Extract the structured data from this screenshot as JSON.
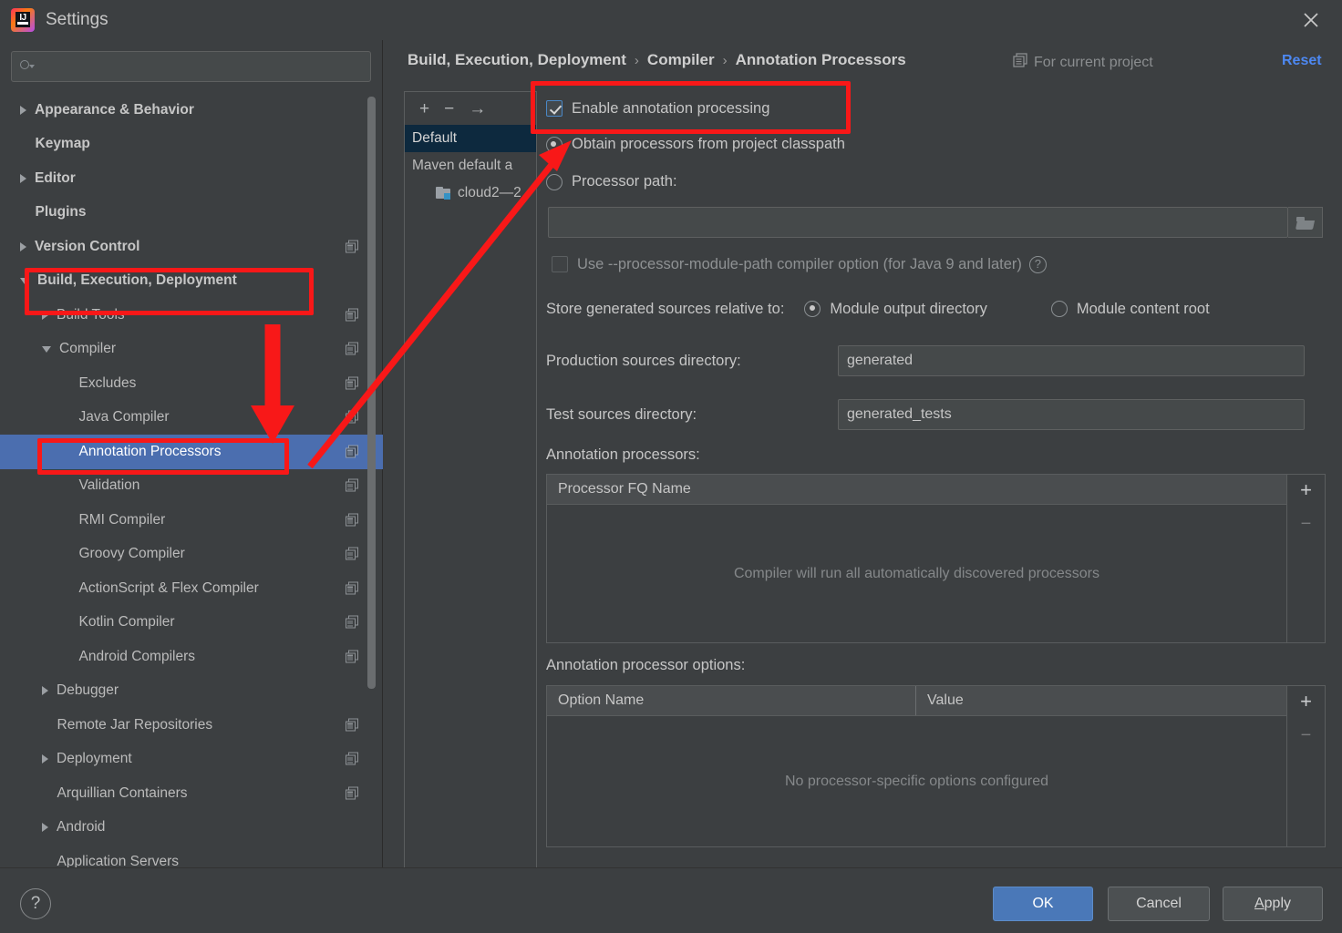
{
  "window": {
    "title": "Settings",
    "logo_icon": "intellij-idea-logo",
    "close_icon": "close-icon"
  },
  "search": {
    "placeholder": "",
    "value": "",
    "icon": "search-icon"
  },
  "sidebar": {
    "items": [
      {
        "label": "Appearance & Behavior",
        "indent": 0,
        "twisty": "collapsed",
        "bold": true,
        "copy": false,
        "selected": false
      },
      {
        "label": "Keymap",
        "indent": 0,
        "twisty": "none",
        "bold": true,
        "copy": false,
        "selected": false
      },
      {
        "label": "Editor",
        "indent": 0,
        "twisty": "collapsed",
        "bold": true,
        "copy": false,
        "selected": false
      },
      {
        "label": "Plugins",
        "indent": 0,
        "twisty": "none",
        "bold": true,
        "copy": false,
        "selected": false
      },
      {
        "label": "Version Control",
        "indent": 0,
        "twisty": "collapsed",
        "bold": true,
        "copy": true,
        "selected": false
      },
      {
        "label": "Build, Execution, Deployment",
        "indent": 0,
        "twisty": "open",
        "bold": true,
        "copy": false,
        "selected": false
      },
      {
        "label": "Build Tools",
        "indent": 1,
        "twisty": "collapsed",
        "bold": false,
        "copy": true,
        "selected": false
      },
      {
        "label": "Compiler",
        "indent": 1,
        "twisty": "open",
        "bold": false,
        "copy": true,
        "selected": false
      },
      {
        "label": "Excludes",
        "indent": 2,
        "twisty": "none",
        "bold": false,
        "copy": true,
        "selected": false
      },
      {
        "label": "Java Compiler",
        "indent": 2,
        "twisty": "none",
        "bold": false,
        "copy": true,
        "selected": false
      },
      {
        "label": "Annotation Processors",
        "indent": 2,
        "twisty": "none",
        "bold": false,
        "copy": true,
        "selected": true
      },
      {
        "label": "Validation",
        "indent": 2,
        "twisty": "none",
        "bold": false,
        "copy": true,
        "selected": false
      },
      {
        "label": "RMI Compiler",
        "indent": 2,
        "twisty": "none",
        "bold": false,
        "copy": true,
        "selected": false
      },
      {
        "label": "Groovy Compiler",
        "indent": 2,
        "twisty": "none",
        "bold": false,
        "copy": true,
        "selected": false
      },
      {
        "label": "ActionScript & Flex Compiler",
        "indent": 2,
        "twisty": "none",
        "bold": false,
        "copy": true,
        "selected": false
      },
      {
        "label": "Kotlin Compiler",
        "indent": 2,
        "twisty": "none",
        "bold": false,
        "copy": true,
        "selected": false
      },
      {
        "label": "Android Compilers",
        "indent": 2,
        "twisty": "none",
        "bold": false,
        "copy": true,
        "selected": false
      },
      {
        "label": "Debugger",
        "indent": 1,
        "twisty": "collapsed",
        "bold": false,
        "copy": false,
        "selected": false
      },
      {
        "label": "Remote Jar Repositories",
        "indent": 1,
        "twisty": "none",
        "bold": false,
        "copy": true,
        "selected": false
      },
      {
        "label": "Deployment",
        "indent": 1,
        "twisty": "collapsed",
        "bold": false,
        "copy": true,
        "selected": false
      },
      {
        "label": "Arquillian Containers",
        "indent": 1,
        "twisty": "none",
        "bold": false,
        "copy": true,
        "selected": false
      },
      {
        "label": "Android",
        "indent": 1,
        "twisty": "collapsed",
        "bold": false,
        "copy": false,
        "selected": false
      },
      {
        "label": "Application Servers",
        "indent": 1,
        "twisty": "none",
        "bold": false,
        "copy": false,
        "selected": false
      }
    ]
  },
  "header": {
    "breadcrumb": [
      "Build, Execution, Deployment",
      "Compiler",
      "Annotation Processors"
    ],
    "separator": "›",
    "scope_label": "For current project",
    "scope_icon": "copy-scope-icon",
    "reset_label": "Reset"
  },
  "profiles": {
    "toolbar": {
      "add": "+",
      "remove": "−",
      "move": "→"
    },
    "items": [
      {
        "label": "Default",
        "selected": true,
        "folder": false
      },
      {
        "label": "Maven default a",
        "selected": false,
        "folder": false
      },
      {
        "label": "cloud2—2",
        "selected": false,
        "folder": true
      }
    ]
  },
  "form": {
    "enable_label": "Enable annotation processing",
    "enable_checked": true,
    "source_mode": "classpath",
    "obtain_label": "Obtain processors from project classpath",
    "processor_path_label": "Processor path:",
    "processor_path_value": "",
    "browse_icon": "folder-open-icon",
    "module_path_label": "Use --processor-module-path compiler option (for Java 9 and later)",
    "module_path_checked": false,
    "module_path_help_icon": "help-icon",
    "store_label": "Store generated sources relative to:",
    "store_option_output": "Module output directory",
    "store_option_content": "Module content root",
    "store_selected": "output",
    "production_label": "Production sources directory:",
    "production_value": "generated",
    "test_label": "Test sources directory:",
    "test_value": "generated_tests"
  },
  "processors_table": {
    "title": "Annotation processors:",
    "columns": [
      "Processor FQ Name"
    ],
    "rows": [],
    "empty_text": "Compiler will run all automatically discovered processors",
    "add_icon": "+",
    "remove_icon": "−"
  },
  "options_table": {
    "title": "Annotation processor options:",
    "columns": [
      "Option Name",
      "Value"
    ],
    "rows": [],
    "empty_text": "No processor-specific options configured",
    "add_icon": "+",
    "remove_icon": "−"
  },
  "footer": {
    "help_icon": "?",
    "ok_label": "OK",
    "cancel_label": "Cancel",
    "apply_label_a": "A",
    "apply_label_rest": "pply"
  },
  "colors": {
    "background": "#3c3f41",
    "selection": "#4b6eaf",
    "accent_link": "#4d88f2",
    "primary_button": "#4a78b8",
    "annotation_red": "#f81818",
    "list_selection": "#0d293e"
  }
}
